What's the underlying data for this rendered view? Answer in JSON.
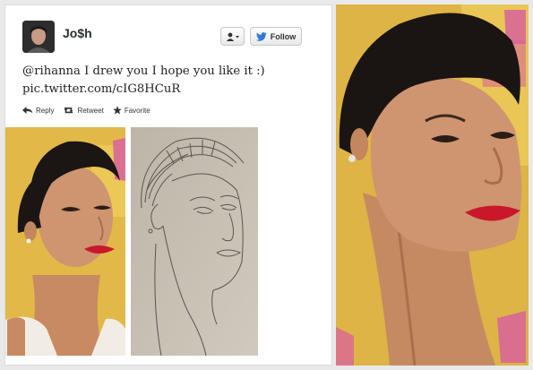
{
  "tweet": {
    "username": "Jo$h",
    "follow_label": "Follow",
    "text_line1": "@rihanna I drew you I hope you like it :)",
    "text_line2": "pic.twitter.com/cIG8HCuR",
    "actions": {
      "reply": "Reply",
      "retweet": "Retweet",
      "favorite": "Favorite"
    }
  },
  "icons": {
    "user": "user-dropdown-icon",
    "bird": "twitter-bird-icon",
    "reply": "reply-arrow-icon",
    "retweet": "retweet-icon",
    "favorite": "star-icon"
  },
  "colors": {
    "accent": "#2e7bcf",
    "text": "#222222",
    "lips": "#c8182a",
    "backdrop": "#e0b847",
    "pink_logo": "#d8619c"
  }
}
